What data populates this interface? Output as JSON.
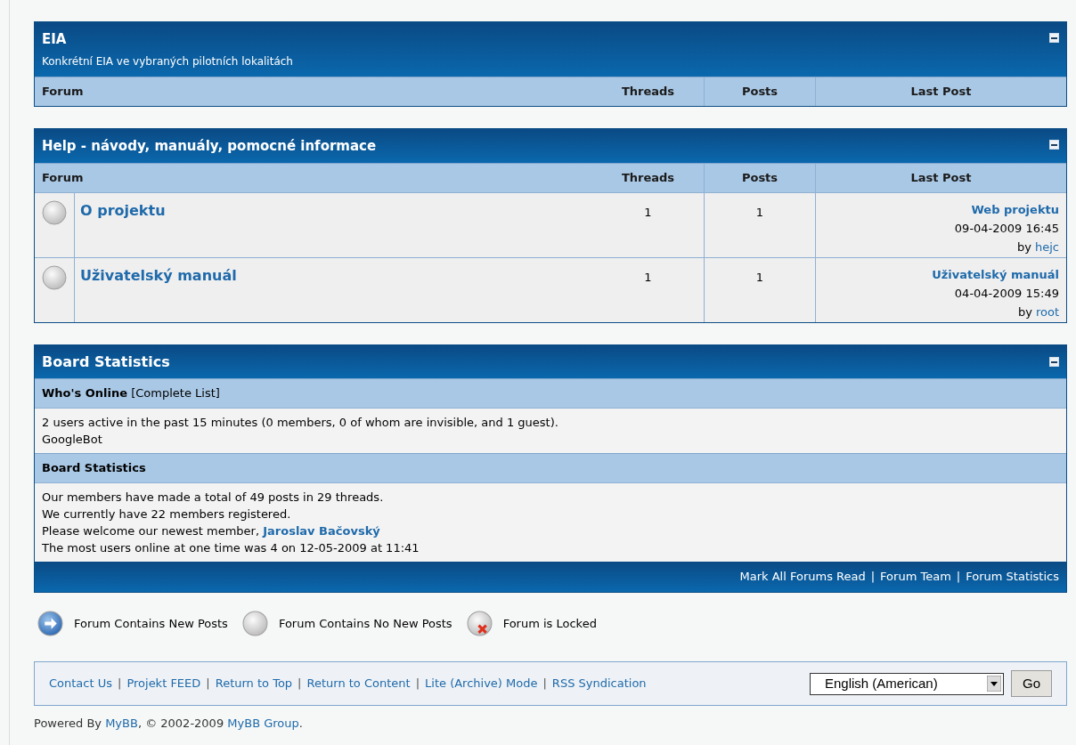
{
  "categories": [
    {
      "title": "EIA",
      "description": "Konkrétní EIA ve vybraných pilotních lokalitách",
      "collapsed": false,
      "columns": [
        "Forum",
        "Threads",
        "Posts",
        "Last Post"
      ]
    },
    {
      "title": "Help - návody, manuály, pomocné informace",
      "collapsed": false,
      "columns": [
        "Forum",
        "Threads",
        "Posts",
        "Last Post"
      ],
      "forums": [
        {
          "name": "O projektu",
          "kind": "no_new",
          "threads": "1",
          "posts": "1",
          "last_post": {
            "title": "Web projektu",
            "date": "09-04-2009 16:45",
            "by": "by",
            "author": "hejc"
          }
        },
        {
          "name": "Uživatelský manuál",
          "kind": "no_new",
          "threads": "1",
          "posts": "1",
          "last_post": {
            "title": "Uživatelský manuál",
            "date": "04-04-2009 15:49",
            "by": "by",
            "author": "root"
          }
        }
      ]
    }
  ],
  "stats": {
    "title": "Board Statistics",
    "collapsed": false,
    "sections": [
      {
        "heading": "**Who's Online** [Complete List]",
        "lines": [
          [
            {
              "text": "2 users active in the past 15 minutes (0 members, 0 of whom are invisible, and 1 guest)."
            }
          ],
          [
            {
              "text": "GoogleBot"
            }
          ]
        ]
      },
      {
        "heading": "**Board Statistics**",
        "lines": [
          [
            {
              "text": "Our members have made a total of 49 posts in 29 threads."
            }
          ],
          [
            {
              "text": "We currently have 22 members registered."
            }
          ],
          [
            {
              "text": "Please welcome our newest member, "
            },
            {
              "link": "Jaroslav Bačovský"
            }
          ],
          [
            {
              "text": "The most users online at one time was 4 on 12-05-2009 at 11:41"
            }
          ]
        ]
      }
    ],
    "footer_links": [
      "Mark All Forums Read",
      "Forum Team",
      "Forum Statistics"
    ],
    "separator": "|"
  },
  "legend": [
    {
      "kind": "new",
      "label": "Forum Contains New Posts"
    },
    {
      "kind": "no_new",
      "label": "Forum Contains No New Posts"
    },
    {
      "kind": "locked",
      "label": "Forum is Locked"
    }
  ],
  "footer": {
    "links": [
      "Contact Us",
      "Projekt FEED",
      "Return to Top",
      "Return to Content",
      "Lite (Archive) Mode",
      "RSS Syndication"
    ],
    "separator": "|",
    "language": "English (American)",
    "go": "Go"
  },
  "powered": [
    {
      "text": "Powered By "
    },
    {
      "link": "MyBB"
    },
    {
      "text": ", © 2002-2009 "
    },
    {
      "link": "MyBB Group"
    },
    {
      "text": "."
    }
  ]
}
